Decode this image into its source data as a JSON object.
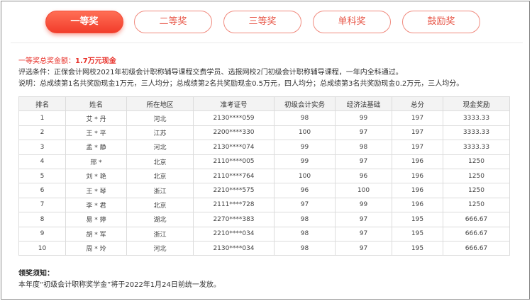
{
  "tabs": [
    {
      "label": "一等奖",
      "active": true
    },
    {
      "label": "二等奖",
      "active": false
    },
    {
      "label": "三等奖",
      "active": false
    },
    {
      "label": "单科奖",
      "active": false
    },
    {
      "label": "鼓励奖",
      "active": false
    }
  ],
  "prize": {
    "label": "一等奖总奖金额：",
    "amount": "1.7万元现金"
  },
  "criteria": "评选条件：正保会计网校2021年初级会计职称辅导课程交费学员、选报网校2门初级会计职称辅导课程，一年内全科通过。",
  "note": "说明：总成绩第1名共奖励现金1万元，三人均分；总成绩第2名共奖励现金0.5万元，四人均分；总成绩第3名共奖励现金0.2万元，三人均分。",
  "table": {
    "headers": [
      "排名",
      "姓名",
      "所在地区",
      "准考证号",
      "初级会计实务",
      "经济法基础",
      "总分",
      "现金奖励"
    ],
    "rows": [
      [
        "1",
        "艾 * 丹",
        "河北",
        "2130****059",
        "98",
        "99",
        "197",
        "3333.33"
      ],
      [
        "2",
        "王 * 平",
        "江苏",
        "2200****330",
        "100",
        "97",
        "197",
        "3333.33"
      ],
      [
        "3",
        "孟 * 静",
        "河北",
        "2130****074",
        "99",
        "98",
        "197",
        "3333.33"
      ],
      [
        "4",
        "邢 *",
        "北京",
        "2110****005",
        "99",
        "97",
        "196",
        "1250"
      ],
      [
        "5",
        "刘 * 艳",
        "北京",
        "2110****764",
        "100",
        "96",
        "196",
        "1250"
      ],
      [
        "6",
        "王 * 琴",
        "浙江",
        "2210****575",
        "96",
        "100",
        "196",
        "1250"
      ],
      [
        "7",
        "李 * 君",
        "北京",
        "2111****728",
        "97",
        "99",
        "196",
        "1250"
      ],
      [
        "8",
        "易 * 婷",
        "湖北",
        "2270****383",
        "98",
        "97",
        "195",
        "666.67"
      ],
      [
        "9",
        "胡 * 军",
        "浙江",
        "2210****034",
        "98",
        "97",
        "195",
        "666.67"
      ],
      [
        "10",
        "周 * 玲",
        "河北",
        "2130****034",
        "98",
        "97",
        "195",
        "666.67"
      ]
    ]
  },
  "footer": {
    "title": "领奖须知：",
    "text": "本年度“初级会计职称奖学金”将于2022年1月24日前统一发放。"
  }
}
